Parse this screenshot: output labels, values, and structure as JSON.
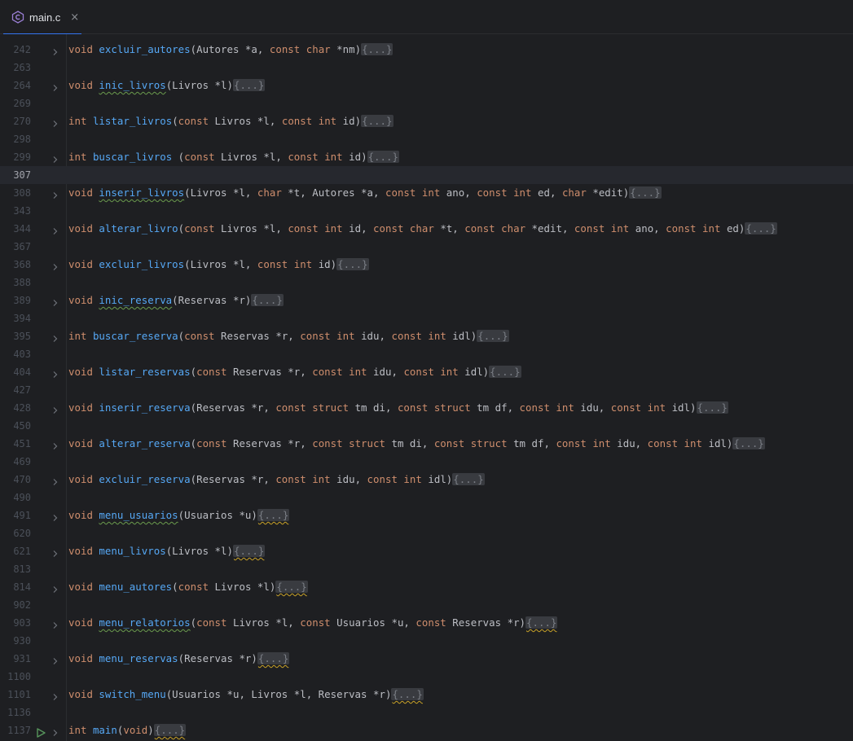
{
  "tab": {
    "filename": "main.c",
    "close": "×",
    "icon": "c-file-icon"
  },
  "colors": {
    "keyword": "#cf8e6d",
    "function": "#56a8f5",
    "text": "#bcbec4",
    "line_number": "#4b5059",
    "accent": "#3574f0"
  },
  "editor": {
    "current_line": "307",
    "lines": [
      {
        "n": "242",
        "tokens": [
          [
            "kw",
            "void"
          ],
          [
            "pl",
            " "
          ],
          [
            "fn",
            "excluir_autores"
          ],
          [
            "pl",
            "(Autores *a, "
          ],
          [
            "kw",
            "const char"
          ],
          [
            "pl",
            " *nm)"
          ],
          [
            "fold",
            "{...}"
          ]
        ]
      },
      {
        "n": "263",
        "tokens": []
      },
      {
        "n": "264",
        "tokens": [
          [
            "kw",
            "void"
          ],
          [
            "pl",
            " "
          ],
          [
            "fnw",
            "inic_livros"
          ],
          [
            "pl",
            "(Livros *l)"
          ],
          [
            "fold",
            "{...}"
          ]
        ]
      },
      {
        "n": "269",
        "tokens": []
      },
      {
        "n": "270",
        "tokens": [
          [
            "kw",
            "int"
          ],
          [
            "pl",
            " "
          ],
          [
            "fn",
            "listar_livros"
          ],
          [
            "pl",
            "("
          ],
          [
            "kw",
            "const"
          ],
          [
            "pl",
            " Livros *l, "
          ],
          [
            "kw",
            "const int"
          ],
          [
            "pl",
            " id)"
          ],
          [
            "fold",
            "{...}"
          ]
        ]
      },
      {
        "n": "298",
        "tokens": []
      },
      {
        "n": "299",
        "tokens": [
          [
            "kw",
            "int"
          ],
          [
            "pl",
            " "
          ],
          [
            "fn",
            "buscar_livros"
          ],
          [
            "pl",
            " ("
          ],
          [
            "kw",
            "const"
          ],
          [
            "pl",
            " Livros *l, "
          ],
          [
            "kw",
            "const int"
          ],
          [
            "pl",
            " id)"
          ],
          [
            "fold",
            "{...}"
          ]
        ]
      },
      {
        "n": "307",
        "tokens": []
      },
      {
        "n": "308",
        "tokens": [
          [
            "kw",
            "void"
          ],
          [
            "pl",
            " "
          ],
          [
            "fnw",
            "inserir_livros"
          ],
          [
            "pl",
            "(Livros *l, "
          ],
          [
            "kw",
            "char"
          ],
          [
            "pl",
            " *t, Autores *a, "
          ],
          [
            "kw",
            "const int"
          ],
          [
            "pl",
            " ano, "
          ],
          [
            "kw",
            "const int"
          ],
          [
            "pl",
            " ed, "
          ],
          [
            "kw",
            "char"
          ],
          [
            "pl",
            " *edit)"
          ],
          [
            "fold",
            "{...}"
          ]
        ]
      },
      {
        "n": "343",
        "tokens": []
      },
      {
        "n": "344",
        "tokens": [
          [
            "kw",
            "void"
          ],
          [
            "pl",
            " "
          ],
          [
            "fn",
            "alterar_livro"
          ],
          [
            "pl",
            "("
          ],
          [
            "kw",
            "const"
          ],
          [
            "pl",
            " Livros *l, "
          ],
          [
            "kw",
            "const int"
          ],
          [
            "pl",
            " id, "
          ],
          [
            "kw",
            "const char"
          ],
          [
            "pl",
            " *t, "
          ],
          [
            "kw",
            "const char"
          ],
          [
            "pl",
            " *edit, "
          ],
          [
            "kw",
            "const int"
          ],
          [
            "pl",
            " ano, "
          ],
          [
            "kw",
            "const int"
          ],
          [
            "pl",
            " ed)"
          ],
          [
            "fold",
            "{...}"
          ]
        ]
      },
      {
        "n": "367",
        "tokens": []
      },
      {
        "n": "368",
        "tokens": [
          [
            "kw",
            "void"
          ],
          [
            "pl",
            " "
          ],
          [
            "fn",
            "excluir_livros"
          ],
          [
            "pl",
            "(Livros *l, "
          ],
          [
            "kw",
            "const int"
          ],
          [
            "pl",
            " id)"
          ],
          [
            "fold",
            "{...}"
          ]
        ]
      },
      {
        "n": "388",
        "tokens": []
      },
      {
        "n": "389",
        "tokens": [
          [
            "kw",
            "void"
          ],
          [
            "pl",
            " "
          ],
          [
            "fnw",
            "inic_reserva"
          ],
          [
            "pl",
            "(Reservas *r)"
          ],
          [
            "fold",
            "{...}"
          ]
        ]
      },
      {
        "n": "394",
        "tokens": []
      },
      {
        "n": "395",
        "tokens": [
          [
            "kw",
            "int"
          ],
          [
            "pl",
            " "
          ],
          [
            "fn",
            "buscar_reserva"
          ],
          [
            "pl",
            "("
          ],
          [
            "kw",
            "const"
          ],
          [
            "pl",
            " Reservas *r, "
          ],
          [
            "kw",
            "const int"
          ],
          [
            "pl",
            " idu, "
          ],
          [
            "kw",
            "const int"
          ],
          [
            "pl",
            " idl)"
          ],
          [
            "fold",
            "{...}"
          ]
        ]
      },
      {
        "n": "403",
        "tokens": []
      },
      {
        "n": "404",
        "tokens": [
          [
            "kw",
            "void"
          ],
          [
            "pl",
            " "
          ],
          [
            "fn",
            "listar_reservas"
          ],
          [
            "pl",
            "("
          ],
          [
            "kw",
            "const"
          ],
          [
            "pl",
            " Reservas *r, "
          ],
          [
            "kw",
            "const int"
          ],
          [
            "pl",
            " idu, "
          ],
          [
            "kw",
            "const int"
          ],
          [
            "pl",
            " idl)"
          ],
          [
            "fold",
            "{...}"
          ]
        ]
      },
      {
        "n": "427",
        "tokens": []
      },
      {
        "n": "428",
        "tokens": [
          [
            "kw",
            "void"
          ],
          [
            "pl",
            " "
          ],
          [
            "fn",
            "inserir_reserva"
          ],
          [
            "pl",
            "(Reservas *r, "
          ],
          [
            "kw",
            "const struct"
          ],
          [
            "pl",
            " tm di, "
          ],
          [
            "kw",
            "const struct"
          ],
          [
            "pl",
            " tm df, "
          ],
          [
            "kw",
            "const int"
          ],
          [
            "pl",
            " idu, "
          ],
          [
            "kw",
            "const int"
          ],
          [
            "pl",
            " idl)"
          ],
          [
            "fold",
            "{...}"
          ]
        ]
      },
      {
        "n": "450",
        "tokens": []
      },
      {
        "n": "451",
        "tokens": [
          [
            "kw",
            "void"
          ],
          [
            "pl",
            " "
          ],
          [
            "fn",
            "alterar_reserva"
          ],
          [
            "pl",
            "("
          ],
          [
            "kw",
            "const"
          ],
          [
            "pl",
            " Reservas *r, "
          ],
          [
            "kw",
            "const struct"
          ],
          [
            "pl",
            " tm di, "
          ],
          [
            "kw",
            "const struct"
          ],
          [
            "pl",
            " tm df, "
          ],
          [
            "kw",
            "const int"
          ],
          [
            "pl",
            " idu, "
          ],
          [
            "kw",
            "const int"
          ],
          [
            "pl",
            " idl)"
          ],
          [
            "fold",
            "{...}"
          ]
        ]
      },
      {
        "n": "469",
        "tokens": []
      },
      {
        "n": "470",
        "tokens": [
          [
            "kw",
            "void"
          ],
          [
            "pl",
            " "
          ],
          [
            "fn",
            "excluir_reserva"
          ],
          [
            "pl",
            "(Reservas *r, "
          ],
          [
            "kw",
            "const int"
          ],
          [
            "pl",
            " idu, "
          ],
          [
            "kw",
            "const int"
          ],
          [
            "pl",
            " idl)"
          ],
          [
            "fold",
            "{...}"
          ]
        ]
      },
      {
        "n": "490",
        "tokens": []
      },
      {
        "n": "491",
        "tokens": [
          [
            "kw",
            "void"
          ],
          [
            "pl",
            " "
          ],
          [
            "fnw",
            "menu_usuarios"
          ],
          [
            "pl",
            "(Usuarios *u)"
          ],
          [
            "foldw",
            "{...}"
          ]
        ]
      },
      {
        "n": "620",
        "tokens": []
      },
      {
        "n": "621",
        "tokens": [
          [
            "kw",
            "void"
          ],
          [
            "pl",
            " "
          ],
          [
            "fn",
            "menu_livros"
          ],
          [
            "pl",
            "(Livros *l)"
          ],
          [
            "foldw",
            "{...}"
          ]
        ]
      },
      {
        "n": "813",
        "tokens": []
      },
      {
        "n": "814",
        "tokens": [
          [
            "kw",
            "void"
          ],
          [
            "pl",
            " "
          ],
          [
            "fn",
            "menu_autores"
          ],
          [
            "pl",
            "("
          ],
          [
            "kw",
            "const"
          ],
          [
            "pl",
            " Livros *l)"
          ],
          [
            "foldw",
            "{...}"
          ]
        ]
      },
      {
        "n": "902",
        "tokens": []
      },
      {
        "n": "903",
        "tokens": [
          [
            "kw",
            "void"
          ],
          [
            "pl",
            " "
          ],
          [
            "fnw",
            "menu_relatorios"
          ],
          [
            "pl",
            "("
          ],
          [
            "kw",
            "const"
          ],
          [
            "pl",
            " Livros *l, "
          ],
          [
            "kw",
            "const"
          ],
          [
            "pl",
            " Usuarios *u, "
          ],
          [
            "kw",
            "const"
          ],
          [
            "pl",
            " Reservas *r)"
          ],
          [
            "foldw",
            "{...}"
          ]
        ]
      },
      {
        "n": "930",
        "tokens": []
      },
      {
        "n": "931",
        "tokens": [
          [
            "kw",
            "void"
          ],
          [
            "pl",
            " "
          ],
          [
            "fn",
            "menu_reservas"
          ],
          [
            "pl",
            "(Reservas *r)"
          ],
          [
            "foldw",
            "{...}"
          ]
        ]
      },
      {
        "n": "1100",
        "tokens": []
      },
      {
        "n": "1101",
        "tokens": [
          [
            "kw",
            "void"
          ],
          [
            "pl",
            " "
          ],
          [
            "fn",
            "switch_menu"
          ],
          [
            "pl",
            "(Usuarios *u, Livros *l, Reservas *r)"
          ],
          [
            "foldw",
            "{...}"
          ]
        ]
      },
      {
        "n": "1136",
        "tokens": []
      },
      {
        "n": "1137",
        "run": true,
        "tokens": [
          [
            "kw",
            "int"
          ],
          [
            "pl",
            " "
          ],
          [
            "fn",
            "main"
          ],
          [
            "pl",
            "("
          ],
          [
            "kw",
            "void"
          ],
          [
            "pl",
            ")"
          ],
          [
            "foldw",
            "{...}"
          ]
        ]
      }
    ]
  }
}
